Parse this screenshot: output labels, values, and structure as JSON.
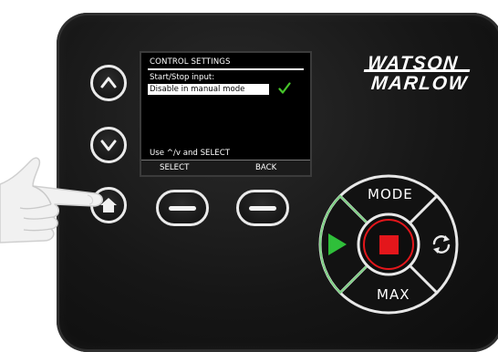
{
  "display": {
    "title": "CONTROL SETTINGS",
    "line1": "Start/Stop input:",
    "selected_item": "Disable in manual mode",
    "hint": "Use ^/v and SELECT",
    "softkey_left": "SELECT",
    "softkey_right": "BACK"
  },
  "brand": {
    "line1": "WATSON",
    "line2": "MARLOW"
  },
  "keypad": {
    "mode_label": "MODE",
    "max_label": "MAX"
  },
  "icons": {
    "up": "chevron-up-icon",
    "down": "chevron-down-icon",
    "home": "home-icon",
    "start": "play-icon",
    "stop": "stop-icon",
    "direction": "rotate-icon",
    "checkmark": "checkmark-icon"
  },
  "colors": {
    "panel": "#161616",
    "screen_bg": "#000000",
    "start_green": "#2fbf3a",
    "stop_red": "#e3161b",
    "check_green": "#46c52a"
  }
}
